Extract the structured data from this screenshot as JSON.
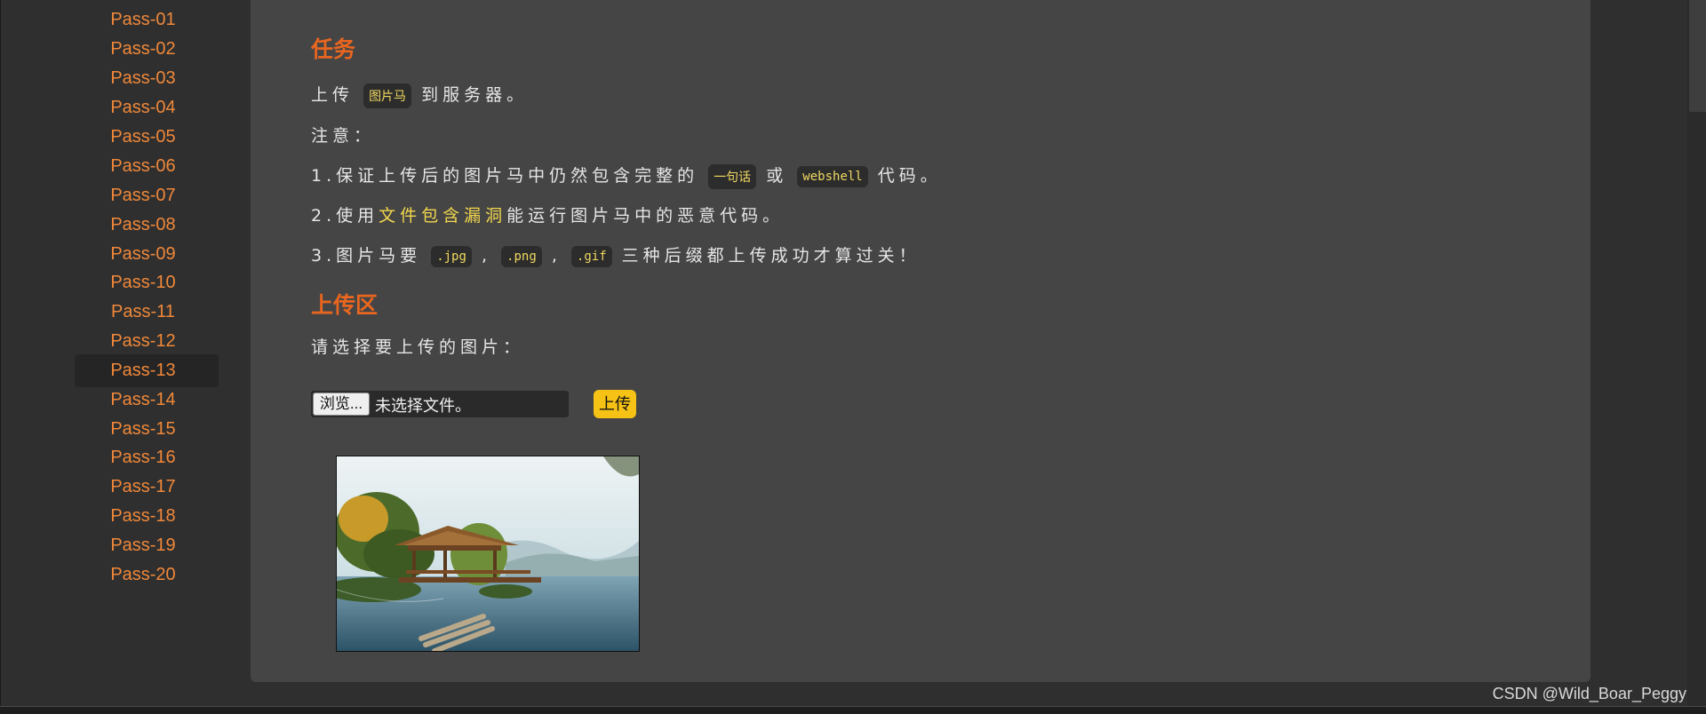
{
  "sidebar": {
    "items": [
      {
        "label": "Pass-01"
      },
      {
        "label": "Pass-02"
      },
      {
        "label": "Pass-03"
      },
      {
        "label": "Pass-04"
      },
      {
        "label": "Pass-05"
      },
      {
        "label": "Pass-06"
      },
      {
        "label": "Pass-07"
      },
      {
        "label": "Pass-08"
      },
      {
        "label": "Pass-09"
      },
      {
        "label": "Pass-10"
      },
      {
        "label": "Pass-11"
      },
      {
        "label": "Pass-12"
      },
      {
        "label": "Pass-13",
        "active": true
      },
      {
        "label": "Pass-14"
      },
      {
        "label": "Pass-15"
      },
      {
        "label": "Pass-16"
      },
      {
        "label": "Pass-17"
      },
      {
        "label": "Pass-18"
      },
      {
        "label": "Pass-19"
      },
      {
        "label": "Pass-20"
      }
    ]
  },
  "task": {
    "heading": "任务",
    "line1": {
      "before": "上传",
      "code": "图片马",
      "after": "到服务器。"
    },
    "note_label": "注意：",
    "note1": {
      "before": "1.保证上传后的图片马中仍然包含完整的",
      "code1": "一句话",
      "middle": "或",
      "code2": "webshell",
      "after": "代码。"
    },
    "note2": {
      "before": "2.使用",
      "highlight": "文件包含漏洞",
      "after": "能运行图片马中的恶意代码。"
    },
    "note3": {
      "before": "3.图片马要",
      "code1": ".jpg",
      "sep1": ",",
      "code2": ".png",
      "sep2": ",",
      "code3": ".gif",
      "after": "三种后缀都上传成功才算过关！"
    }
  },
  "upload": {
    "heading": "上传区",
    "prompt": "请选择要上传的图片：",
    "browse_label": "浏览...",
    "no_file_label": "未选择文件。",
    "submit_label": "上传"
  },
  "watermark": "CSDN @Wild_Boar_Peggy",
  "colors": {
    "accent": "#e8661f",
    "nav": "#f0883a",
    "code_text": "#f0d860",
    "button": "#f6c215",
    "panel": "#454545",
    "page": "#2f2f2f"
  }
}
